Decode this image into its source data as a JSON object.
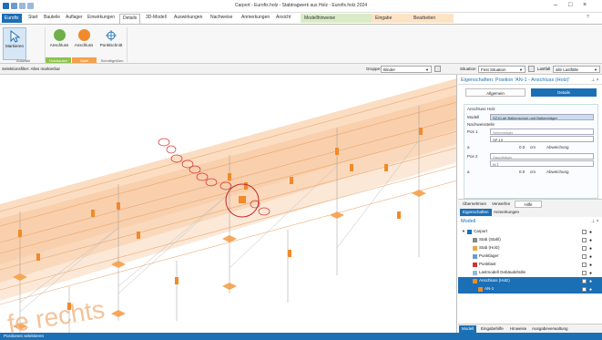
{
  "window": {
    "title": "Carport - Eurofix.holz - Stabtragwerk aus Holz - Eurofix.holz 2024",
    "controls": [
      "–",
      "□",
      "×"
    ]
  },
  "menu": {
    "items": [
      "Eurofix",
      "Start",
      "Bauteile",
      "Auflager",
      "Einwirkungen",
      "Details",
      "3D-Modell",
      "Auswirkungen",
      "Nachweise",
      "Anmerkungen",
      "Ansicht",
      "Modellhinweise",
      "Eingabe",
      "Bearbeiten"
    ],
    "help": "?"
  },
  "ribbon": {
    "buttons": [
      "Markieren",
      "Anschluss",
      "Anschluss",
      "Punktschnitt"
    ],
    "groups": [
      "Auswahl",
      "Holzbauten",
      "Stahl",
      "Schnittgrößen"
    ]
  },
  "toolbar": {
    "selection_label": "Selektionsfilter: Alles markierbar",
    "group_label": "Gruppe:",
    "group_value": "Binder",
    "situation_label": "Situation",
    "situation_value": "Fest Situation",
    "loadcase_label": "Lastfall",
    "loadcase_value": "alle Lastfälle"
  },
  "viewport": {
    "watermark": "fe rechts"
  },
  "properties": {
    "title": "Eigenschaften: Position 'AN-1 - Anschluss (Holz)'",
    "tab_general": "Allgemein",
    "tab_details": "Details",
    "section_title": "Anschluss Holz",
    "model_label": "Modell",
    "model_value": "SZ10-de Balkenschuh und Balkenträger",
    "nachweis_label": "Nachweisstelle",
    "pos1_label": "Pos 1",
    "pos1_name": "Nebenträger",
    "pos1_value": "SP-19",
    "a_label": "a",
    "a1_value": "0.0",
    "unit": "cm",
    "deviation": "Abweichung",
    "pos2_label": "Pos 2",
    "pos2_name": "Hauptträger",
    "pos2_value": "H-7",
    "a2_value": "0.0"
  },
  "midtabs": {
    "row1": [
      "Übernehmen",
      "Verwerfen",
      "Hilfe"
    ],
    "row2": [
      "Eigenschaften",
      "Anmerkungen"
    ]
  },
  "tree": {
    "title": "Modell",
    "items": [
      {
        "label": "Carport",
        "indent": 1,
        "selected": false
      },
      {
        "label": "Stab (Stahl)",
        "indent": 2,
        "selected": false
      },
      {
        "label": "Stab (Holz)",
        "indent": 2,
        "selected": false
      },
      {
        "label": "Punktlager",
        "indent": 2,
        "selected": false
      },
      {
        "label": "Punktlast",
        "indent": 2,
        "selected": false
      },
      {
        "label": "Lastmodell Gebäudehülle",
        "indent": 2,
        "selected": false
      },
      {
        "label": "Anschluss (Holz)",
        "indent": 2,
        "selected": true
      },
      {
        "label": "AN-1",
        "indent": 3,
        "selected": true
      }
    ]
  },
  "bottomtabs": [
    "Modell",
    "Eingabehilfe",
    "Hinweise",
    "Ausgabeverwaltung"
  ],
  "status": {
    "text": "Positionen selektieren"
  },
  "colors": {
    "accent": "#1b6fb5",
    "roof": "#f7c9a0",
    "member": "#f08a2a",
    "highlight": "#d23434"
  }
}
